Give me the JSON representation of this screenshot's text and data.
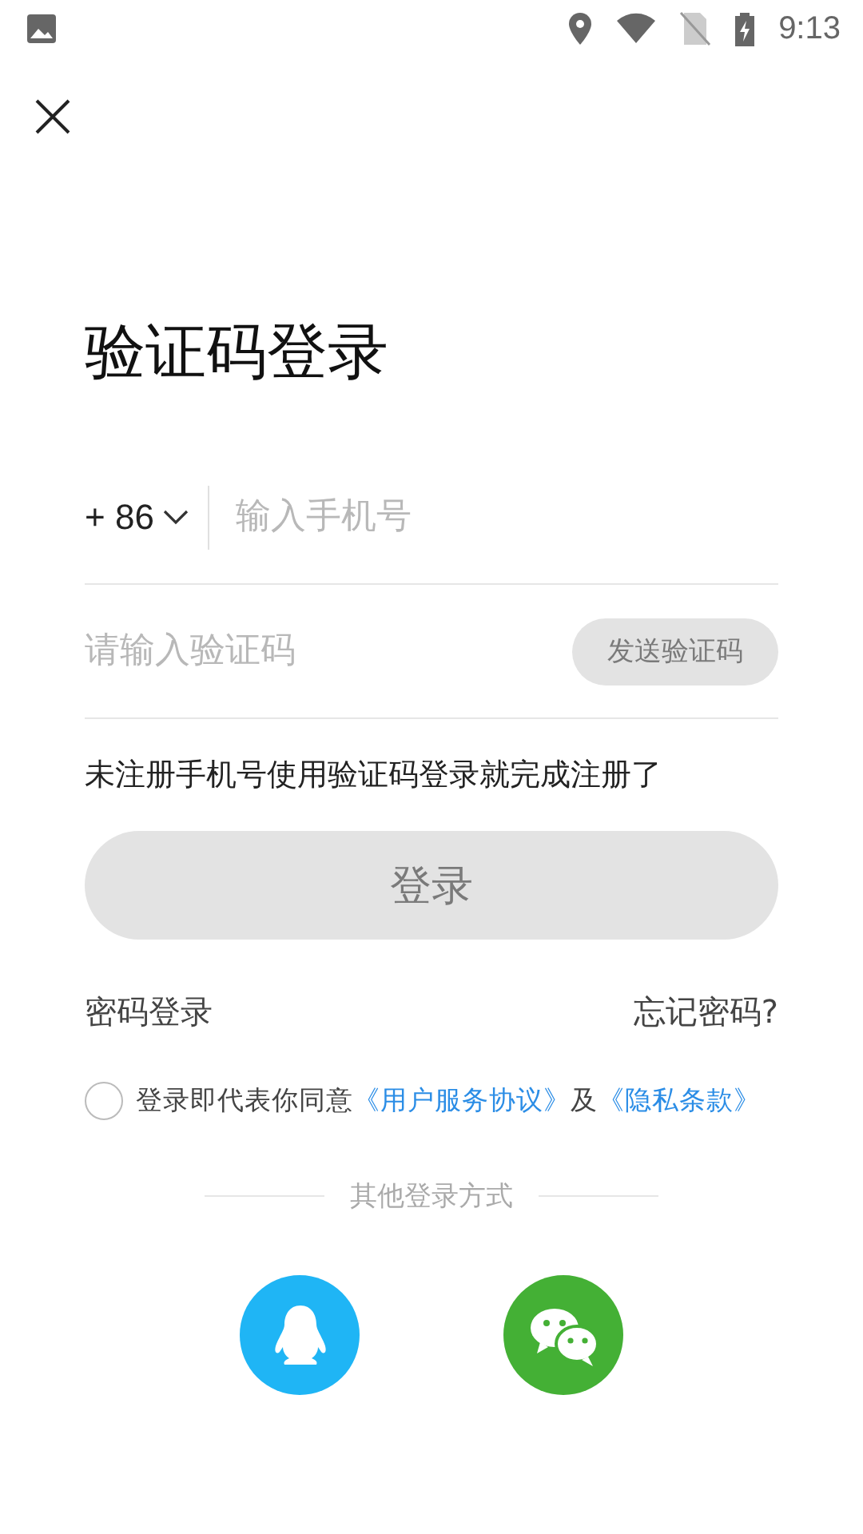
{
  "status_bar": {
    "time": "9:13"
  },
  "title": "验证码登录",
  "phone": {
    "country_code": "+ 86",
    "placeholder": "输入手机号"
  },
  "code": {
    "placeholder": "请输入验证码"
  },
  "send_code_button": {
    "label": "发送验证码",
    "disabled": true
  },
  "hint": "未注册手机号使用验证码登录就完成注册了",
  "login_button": {
    "label": "登录",
    "disabled": true
  },
  "password_login": "密码登录",
  "forgot_password": "忘记密码?",
  "agreement": {
    "checked": false,
    "prefix": "登录即代表你同意",
    "terms_link": "《用户服务协议》",
    "joiner": "及",
    "privacy_link": "《隐私条款》"
  },
  "other_login": {
    "label": "其他登录方式",
    "methods": [
      {
        "kind": "qq"
      },
      {
        "kind": "wechat"
      }
    ]
  }
}
